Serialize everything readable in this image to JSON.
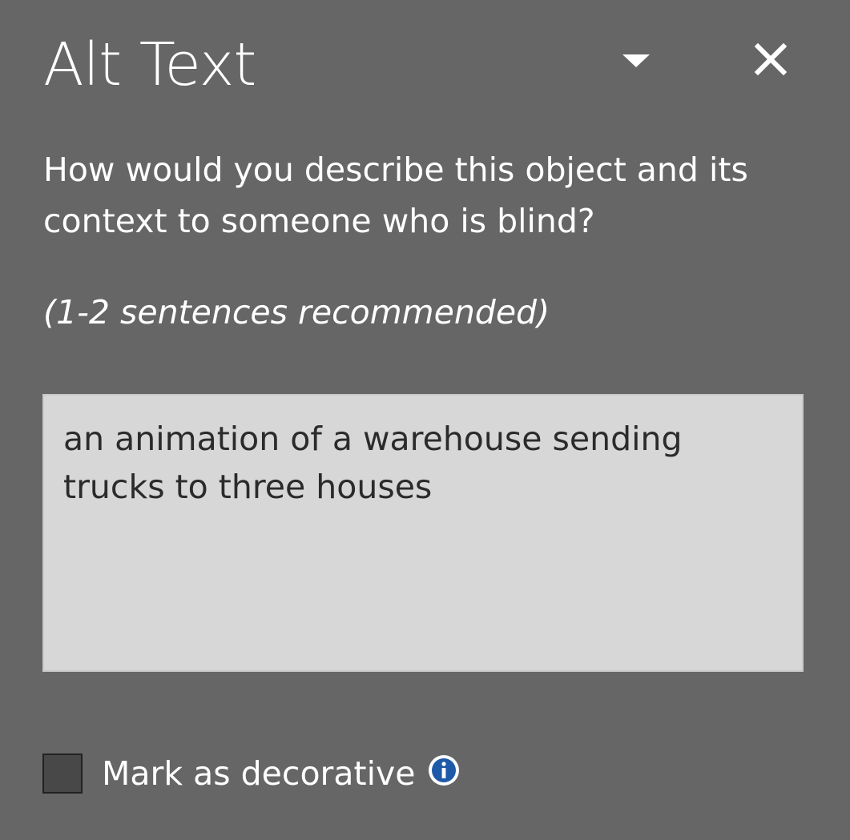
{
  "pane": {
    "title": "Alt Text",
    "dropdown_icon": "caret-down-icon",
    "close_icon": "close-icon"
  },
  "prompt": {
    "question": "How would you describe this object and its context to someone who is blind?",
    "hint": "(1-2 sentences recommended)"
  },
  "alt_text": {
    "value": "an animation of a warehouse sending trucks to three houses"
  },
  "decorative": {
    "label": "Mark as decorative",
    "checked": false,
    "info_icon": "info-icon"
  },
  "colors": {
    "background": "#666666",
    "text": "#ffffff",
    "textarea_bg": "#d7d7d7",
    "info_blue": "#1e5aa8"
  }
}
